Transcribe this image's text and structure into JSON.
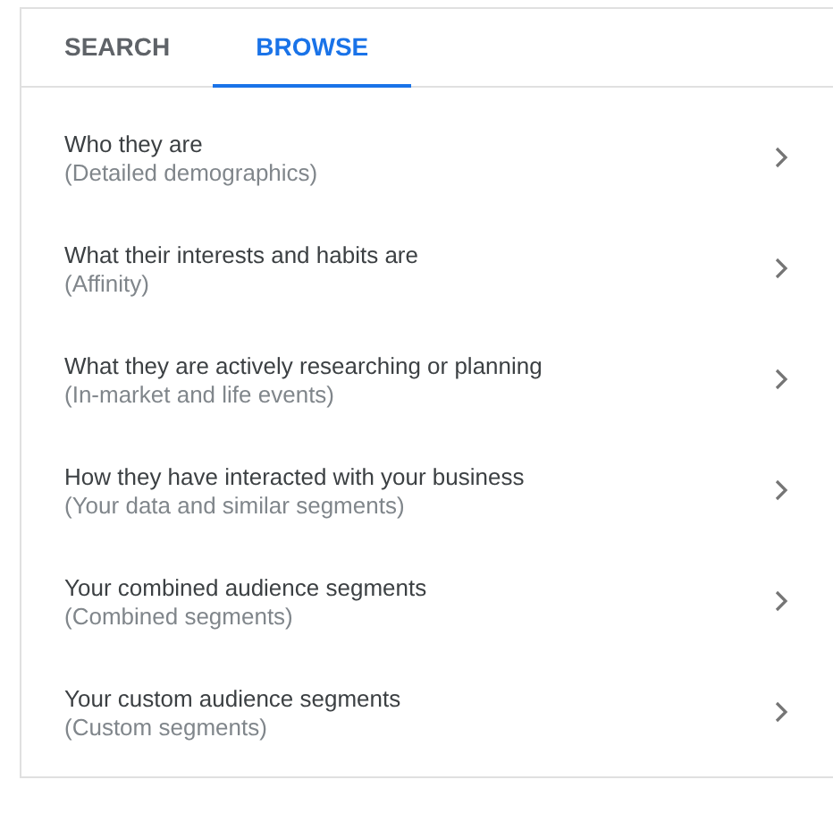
{
  "tabs": [
    {
      "label": "SEARCH",
      "selected": false
    },
    {
      "label": "BROWSE",
      "selected": true
    }
  ],
  "items": [
    {
      "title": "Who they are",
      "subtitle": "(Detailed demographics)"
    },
    {
      "title": "What their interests and habits are",
      "subtitle": "(Affinity)"
    },
    {
      "title": "What they are actively researching or planning",
      "subtitle": "(In-market and life events)"
    },
    {
      "title": "How they have interacted with your business",
      "subtitle": "(Your data and similar segments)"
    },
    {
      "title": "Your combined audience segments",
      "subtitle": "(Combined segments)"
    },
    {
      "title": "Your custom audience segments",
      "subtitle": "(Custom segments)"
    }
  ]
}
